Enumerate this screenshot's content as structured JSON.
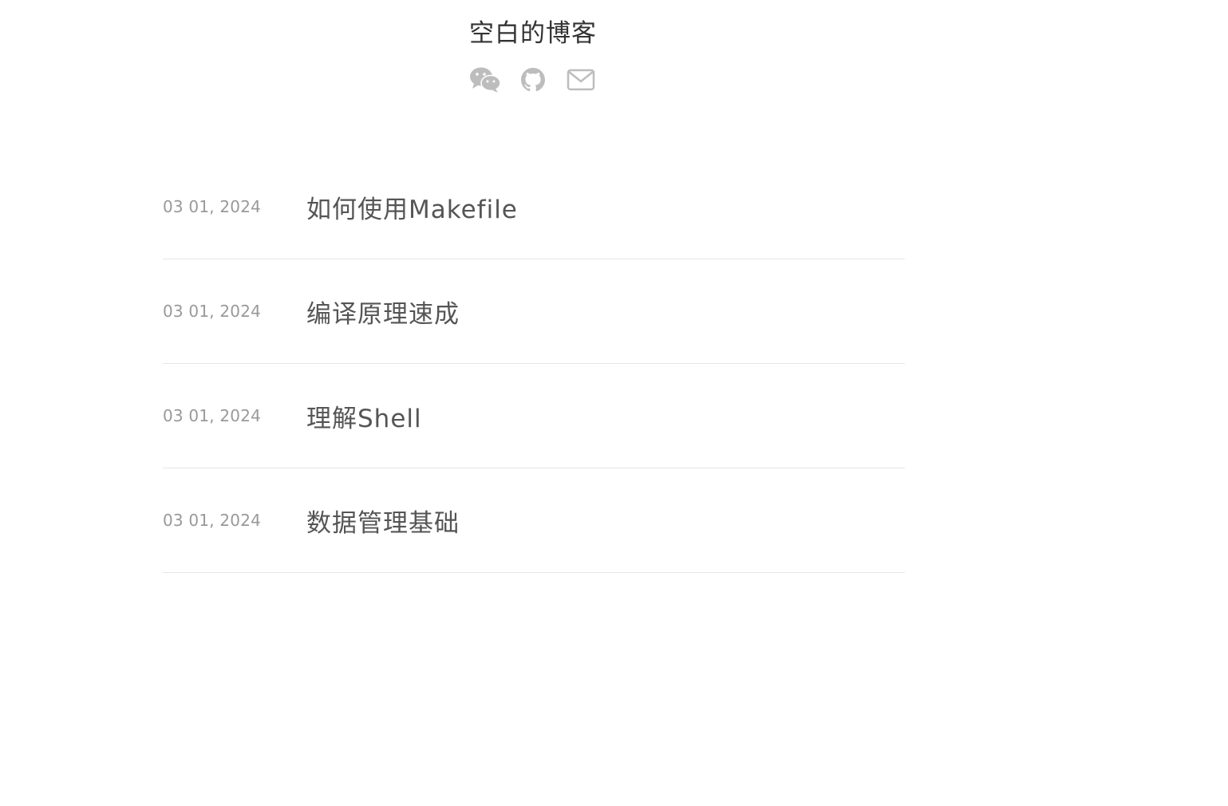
{
  "site": {
    "title": "空白的博客"
  },
  "social": [
    {
      "icon": "wechat-icon"
    },
    {
      "icon": "github-icon"
    },
    {
      "icon": "mail-icon"
    }
  ],
  "posts": [
    {
      "date": "03 01, 2024",
      "title": "如何使用Makefile"
    },
    {
      "date": "03 01, 2024",
      "title": "编译原理速成"
    },
    {
      "date": "03 01, 2024",
      "title": "理解Shell"
    },
    {
      "date": "03 01, 2024",
      "title": "数据管理基础"
    }
  ],
  "colors": {
    "title": "#333333",
    "post_title": "#555555",
    "date": "#999999",
    "icon": "#bdbdbd",
    "divider": "#e6e6e6"
  }
}
